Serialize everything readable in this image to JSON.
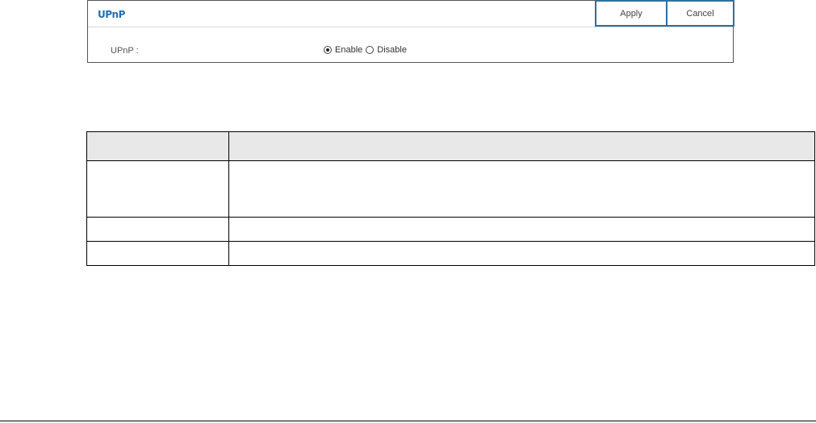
{
  "panel": {
    "title": "UPnP",
    "apply_label": "Apply",
    "cancel_label": "Cancel",
    "field_label": "UPnP :",
    "options": [
      "Enable",
      "Disable"
    ],
    "selected": "Enable"
  },
  "table": {
    "headers": [
      "",
      ""
    ],
    "rows": [
      [
        "",
        ""
      ],
      [
        "",
        ""
      ],
      [
        "",
        ""
      ]
    ]
  }
}
